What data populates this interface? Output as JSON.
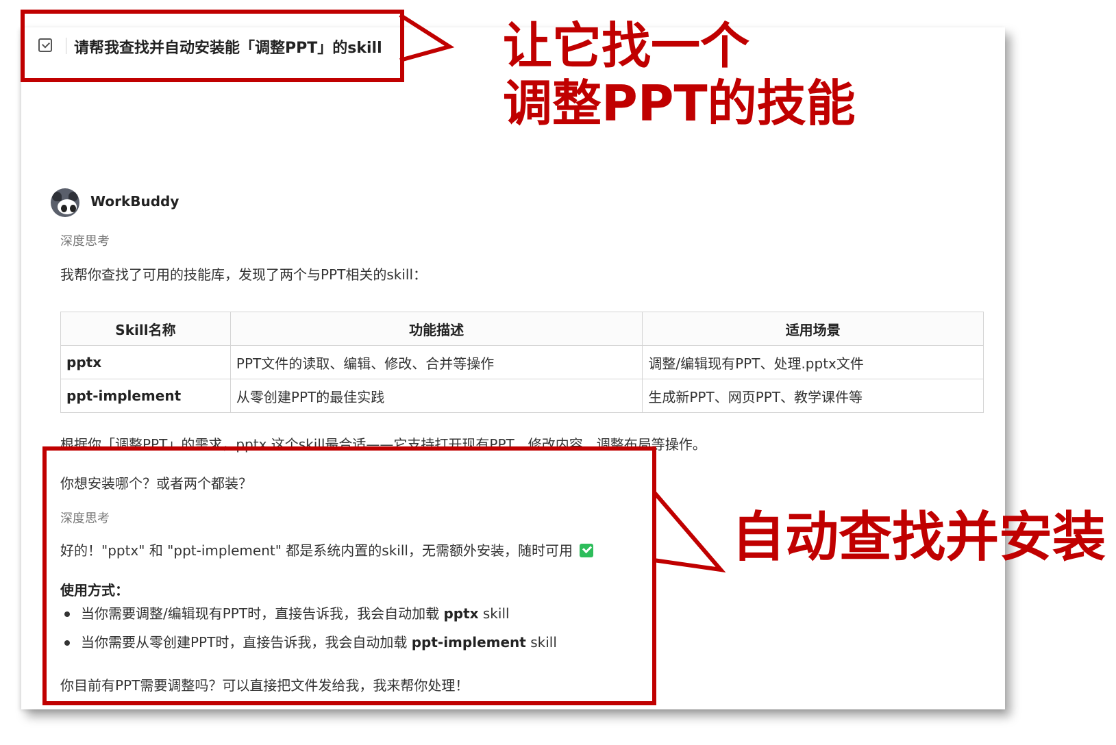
{
  "request": {
    "text": "请帮我查找并自动安装能「调整PPT」的skill"
  },
  "callouts": {
    "top_line1": "让它找一个",
    "top_line2": "调整PPT的技能",
    "bottom": "自动查找并安装"
  },
  "bot": {
    "name": "WorkBuddy"
  },
  "messages": {
    "deep_thinking_1": "深度思考",
    "intro": "我帮你查找了可用的技能库，发现了两个与PPT相关的skill：",
    "recommend": "根据你「调整PPT」的需求，pptx 这个skill最合适——它支持打开现有PPT、修改内容、调整布局等操作。",
    "question": "你想安装哪个？或者两个都装？",
    "deep_thinking_2": "深度思考",
    "answer": "好的！\"pptx\" 和 \"ppt-implement\" 都是系统内置的skill，无需额外安装，随时可用",
    "usage_title": "使用方式：",
    "usage_1_prefix": "当你需要调整/编辑现有PPT时，直接告诉我，我会自动加载",
    "usage_1_skill": "pptx",
    "usage_1_suffix": "skill",
    "usage_2_prefix": "当你需要从零创建PPT时，直接告诉我，我会自动加载",
    "usage_2_skill": "ppt-implement",
    "usage_2_suffix": "skill",
    "closing": "你目前有PPT需要调整吗？可以直接把文件发给我，我来帮你处理！"
  },
  "table": {
    "headers": [
      "Skill名称",
      "功能描述",
      "适用场景"
    ],
    "rows": [
      [
        "pptx",
        "PPT文件的读取、编辑、修改、合并等操作",
        "调整/编辑现有PPT、处理.pptx文件"
      ],
      [
        "ppt-implement",
        "从零创建PPT的最佳实践",
        "生成新PPT、网页PPT、教学课件等"
      ]
    ]
  },
  "colors": {
    "accent_red": "#c00000",
    "check_green": "#2dbd5b"
  }
}
